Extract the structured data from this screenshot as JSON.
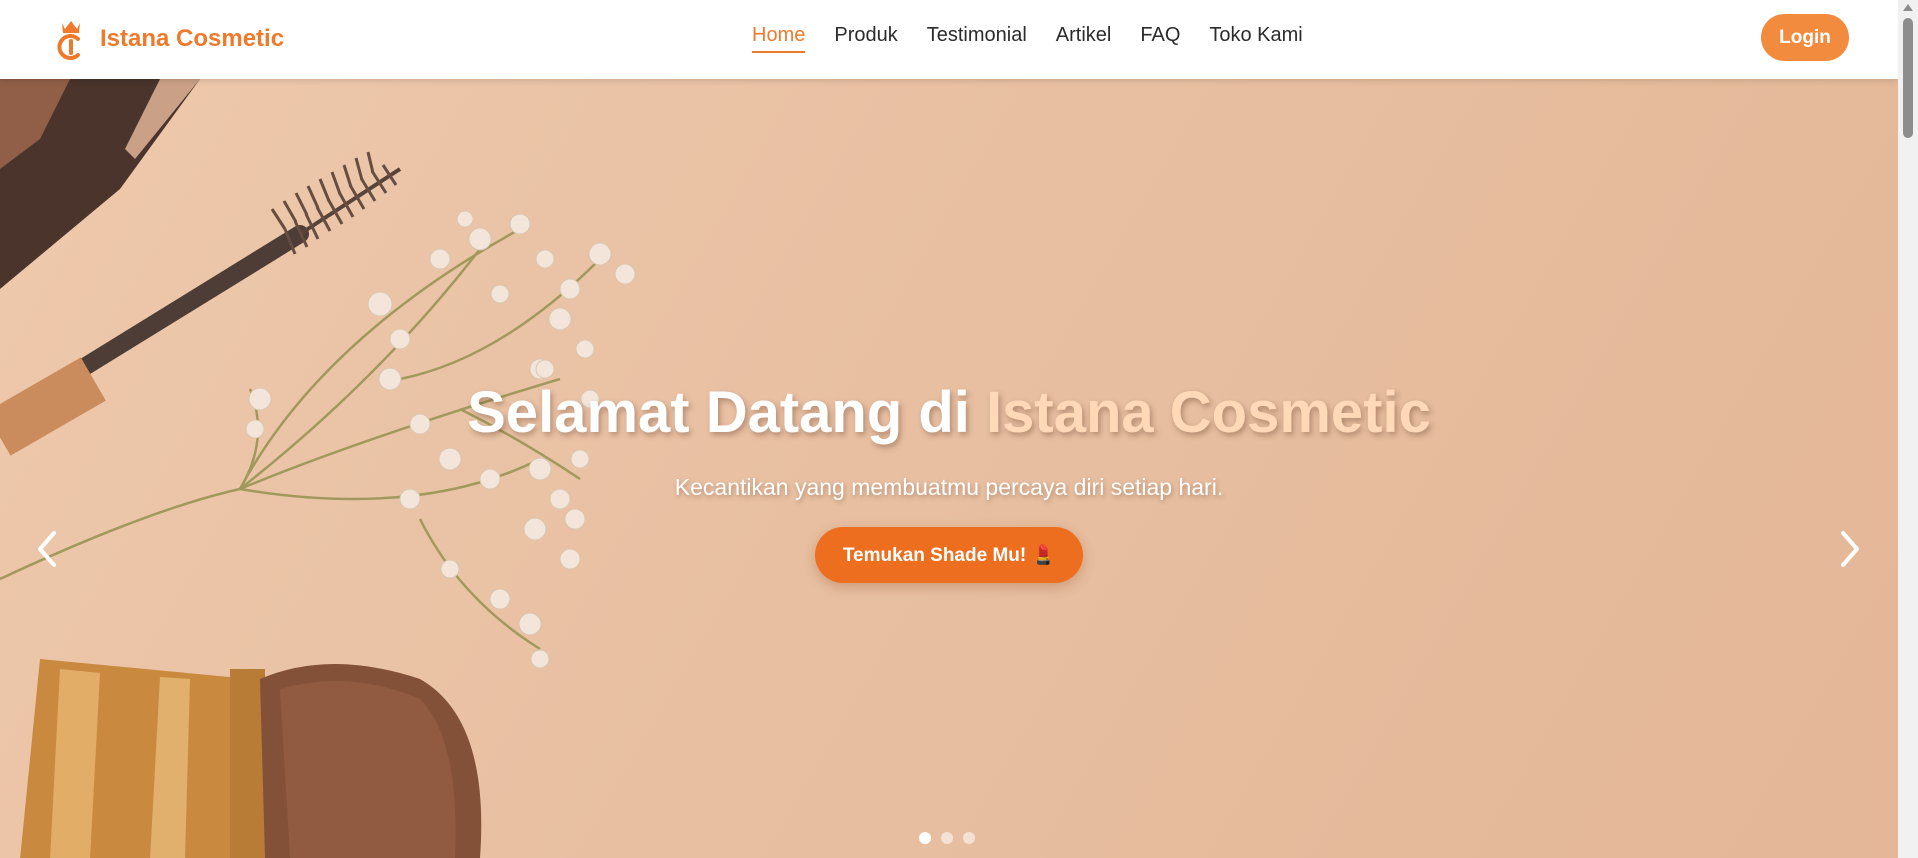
{
  "brand": {
    "name": "Istana Cosmetic",
    "logo_icon": "crown-logo-icon"
  },
  "nav": {
    "items": [
      {
        "label": "Home",
        "active": true
      },
      {
        "label": "Produk"
      },
      {
        "label": "Testimonial"
      },
      {
        "label": "Artikel"
      },
      {
        "label": "FAQ"
      },
      {
        "label": "Toko Kami"
      }
    ],
    "login_label": "Login"
  },
  "hero": {
    "title_prefix": "Selamat Datang di ",
    "title_accent": "Istana Cosmetic",
    "subtitle": "Kecantikan yang membuatmu percaya diri setiap hari.",
    "cta_label": "Temukan Shade Mu! 💄",
    "slides_total": 3,
    "active_slide": 1
  },
  "colors": {
    "accent": "#ef7a2c",
    "cta": "#ee6e1f",
    "login": "#f28b3e",
    "hero_bg": "#eac5a8",
    "title_accent": "#ffd9b8"
  }
}
